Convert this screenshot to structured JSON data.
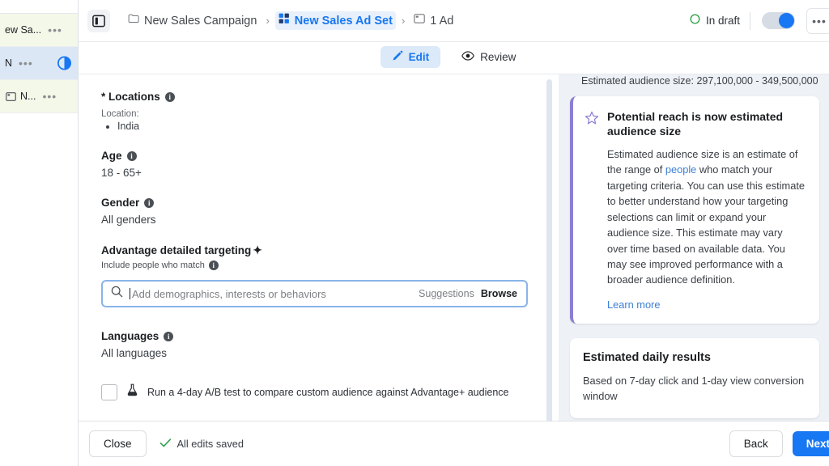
{
  "sidebar": {
    "rows": [
      {
        "label": "ew Sa...",
        "icon": "none",
        "dots": "•••",
        "state": "tinted"
      },
      {
        "label": "N",
        "icon": "none",
        "dots": "•••",
        "state": "selected",
        "trailing_icon": "half-circle-icon"
      },
      {
        "label": "N...",
        "icon": "ad-frame-icon",
        "dots": "•••",
        "state": "tinted"
      }
    ]
  },
  "topbar": {
    "panel_toggle_icon": "panel-toggle-icon",
    "breadcrumb": [
      {
        "label": "New Sales Campaign",
        "icon": "folder-icon",
        "active": false
      },
      {
        "label": "New Sales Ad Set",
        "icon": "grid-squares-icon",
        "active": true
      },
      {
        "label": "1 Ad",
        "icon": "ad-frame-icon",
        "active": false
      }
    ],
    "separator": "›",
    "status_label": "In draft",
    "status_icon": "circle-outline-icon",
    "status_color": "#31a24c",
    "toggle_on": true,
    "toggle_color": "#1877f2",
    "overflow_label": "•••"
  },
  "tabs": [
    {
      "label": "Edit",
      "icon": "pencil-icon",
      "active": true
    },
    {
      "label": "Review",
      "icon": "eye-icon",
      "active": false
    }
  ],
  "form": {
    "locations": {
      "title": "* Locations",
      "sub_label": "Location:",
      "items": [
        "India"
      ]
    },
    "age": {
      "title": "Age",
      "value": "18 - 65+"
    },
    "gender": {
      "title": "Gender",
      "value": "All genders"
    },
    "advantage": {
      "title": "Advantage detailed targeting",
      "sparkle": "✦",
      "sub_label": "Include people who match",
      "search_placeholder": "Add demographics, interests or behaviors",
      "search_value": "",
      "suggestions_label": "Suggestions",
      "browse_label": "Browse",
      "search_icon": "search-icon"
    },
    "languages": {
      "title": "Languages",
      "value": "All languages"
    },
    "ab_test": {
      "label": "Run a 4-day A/B test to compare custom audience against Advantage+ audience",
      "icon": "flask-icon",
      "checked": false
    }
  },
  "right_panel": {
    "audience_size_line": "Estimated audience size: 297,100,000 - 349,500,000",
    "notice": {
      "icon": "star-icon",
      "accent_color": "#8b7fd4",
      "title": "Potential reach is now estimated audience size",
      "body_part1": "Estimated audience size is an estimate of the range of ",
      "body_link": "people",
      "body_part2": " who match your targeting criteria. You can use this estimate to better understand how your targeting selections can limit or expand your audience size. This estimate may vary over time based on available data. You may see improved performance with a broader audience definition.",
      "learn_more": "Learn more"
    },
    "results": {
      "title": "Estimated daily results",
      "subtitle": "Based on 7-day click and 1-day view conversion window"
    }
  },
  "footer": {
    "close_label": "Close",
    "saved_label": "All edits saved",
    "saved_icon": "check-icon",
    "saved_color": "#31a24c",
    "back_label": "Back",
    "next_label": "Next"
  }
}
